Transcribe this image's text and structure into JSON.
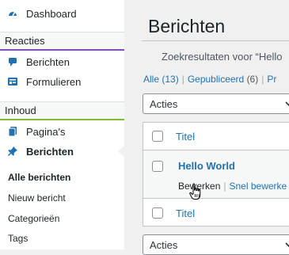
{
  "sidebar": {
    "dashboard": "Dashboard",
    "reacties_header": "Reacties",
    "berichten_reacties": "Berichten",
    "formulieren": "Formulieren",
    "inhoud_header": "Inhoud",
    "paginas": "Pagina's",
    "berichten": "Berichten",
    "submenu": [
      "Alle berichten",
      "Nieuw bericht",
      "Categorieën",
      "Tags"
    ]
  },
  "main": {
    "title": "Berichten",
    "search_results": "Zoekresultaten voor “Hello",
    "filters": {
      "all": "Alle",
      "all_count": "(13)",
      "published": "Gepubliceerd",
      "published_count": "(6)",
      "private_partial": "Pr"
    },
    "bulk_action_top": "Acties",
    "bulk_action_bottom": "Acties",
    "column_title": "Titel",
    "column_title_footer": "Titel",
    "post": {
      "title": "Hello World",
      "edit": "Bewerken",
      "quick_edit": "Snel bewerke"
    }
  },
  "colors": {
    "link": "#2271b1",
    "reacties_accent": "#7c4dbd",
    "inhoud_accent": "#7ebd34"
  }
}
